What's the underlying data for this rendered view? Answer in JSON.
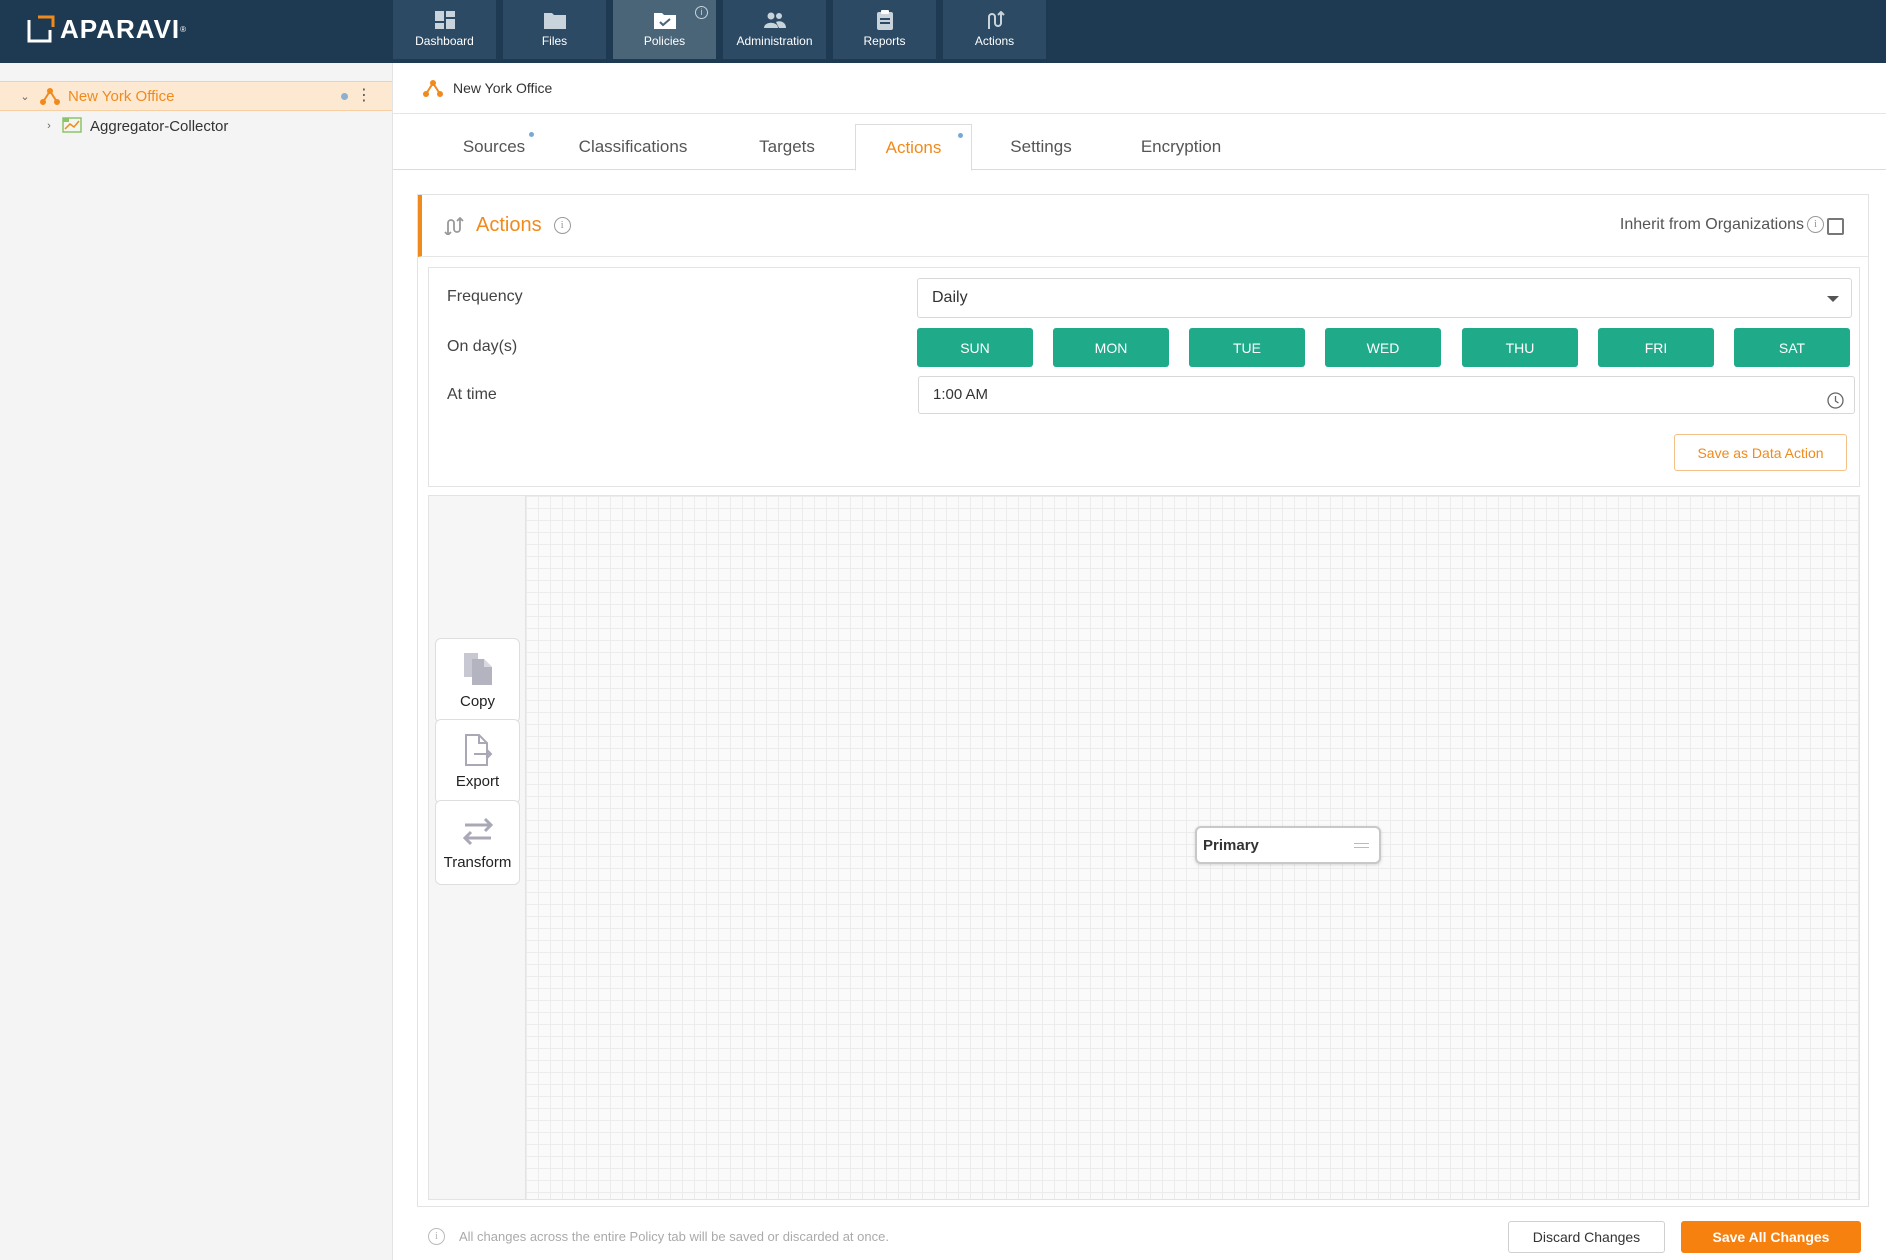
{
  "app": {
    "brand": "APARAVI",
    "colors": {
      "topbar": "#1e3a52",
      "accent": "#f08a1c",
      "day_active": "#1faa89"
    }
  },
  "nav": {
    "tabs": [
      {
        "label": "Dashboard",
        "icon": "dashboard-icon"
      },
      {
        "label": "Files",
        "icon": "folder-icon"
      },
      {
        "label": "Policies",
        "icon": "policies-folder-icon"
      },
      {
        "label": "Administration",
        "icon": "users-icon"
      },
      {
        "label": "Reports",
        "icon": "clipboard-icon"
      },
      {
        "label": "Actions",
        "icon": "actions-icon"
      }
    ],
    "active": "Policies"
  },
  "sidebar": {
    "items": [
      {
        "label": "New York Office",
        "icon": "organization-icon",
        "selected": true
      },
      {
        "label": "Aggregator-Collector",
        "icon": "server-icon",
        "selected": false
      }
    ]
  },
  "breadcrumb": {
    "label": "New York Office"
  },
  "subtabs": {
    "items": [
      "Sources",
      "Classifications",
      "Targets",
      "Actions",
      "Settings",
      "Encryption"
    ],
    "active": "Actions"
  },
  "panel": {
    "title": "Actions",
    "inherit_label": "Inherit from Organizations",
    "frequency_label": "Frequency",
    "frequency_value": "Daily",
    "days_label": "On day(s)",
    "days": [
      "SUN",
      "MON",
      "TUE",
      "WED",
      "THU",
      "FRI",
      "SAT"
    ],
    "time_label": "At time",
    "time_value": "1:00 AM",
    "save_data_action": "Save as Data Action"
  },
  "palette": {
    "items": [
      {
        "label": "Copy",
        "icon": "copy-icon"
      },
      {
        "label": "Export",
        "icon": "export-icon"
      },
      {
        "label": "Transform",
        "icon": "transform-icon"
      }
    ]
  },
  "canvas": {
    "node_label": "Primary"
  },
  "footer": {
    "note": "All changes across the entire Policy tab will be saved or discarded at once.",
    "discard": "Discard Changes",
    "save": "Save All Changes"
  }
}
